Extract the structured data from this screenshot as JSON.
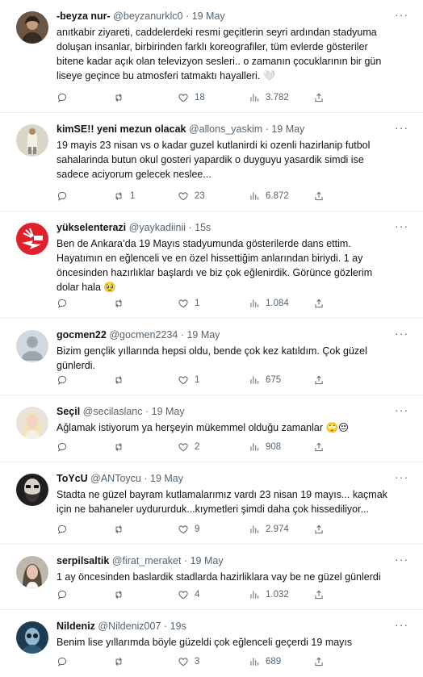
{
  "more_label": "···",
  "tweets": [
    {
      "name": "-beyza nur-",
      "handle": "@beyzanurklc0",
      "time": "19 May",
      "lines": [
        "anıtkabir ziyareti, caddelerdeki resmi geçitlerin seyri ardından stadyuma",
        "doluşan insanlar, birbirinden farklı koreografiler, tüm evlerde gösteriler",
        "bitene kadar açık olan televizyon sesleri.. o zamanın çocuklarının bir gün",
        "liseye geçince bu atmosferi tatmaktı hayalleri. 🤍"
      ],
      "replies": "",
      "retweets": "",
      "likes": "18",
      "views": "3.782"
    },
    {
      "name": "kimSE!! yeni mezun olacak",
      "handle": "@allons_yaskim",
      "time": "19 May",
      "lines": [
        "19 mayis 23 nisan vs o kadar guzel kutlanirdi ki ozenli hazirlanip futbol",
        "sahalarinda butun okul gosteri yapardik o duyguyu yasardik simdi ise",
        "sadece aciyorum gelecek neslee..."
      ],
      "replies": "",
      "retweets": "1",
      "likes": "23",
      "views": "6.872"
    },
    {
      "name": "yükselenterazi",
      "handle": "@yaykadiinii",
      "time": "15s",
      "lines": [
        "Ben de Ankara’da 19 Mayıs stadyumunda gösterilerde dans ettim.",
        "Hayatımın en eğlenceli ve en özel hissettiğim anlarından biriydi. 1 ay",
        "öncesinden hazırlıklar başlardı ve biz çok eğlenirdik. Görünce gözlerim",
        "dolar hala 🥹"
      ],
      "replies": "",
      "retweets": "",
      "likes": "1",
      "views": "1.084"
    },
    {
      "name": "gocmen22",
      "handle": "@gocmen2234",
      "time": "19 May",
      "lines": [
        "Bizim gençlik yıllarında hepsi oldu, bende çok kez katıldım. Çok güzel",
        "günlerdi."
      ],
      "replies": "",
      "retweets": "",
      "likes": "1",
      "views": "675"
    },
    {
      "name": "Seçil",
      "handle": "@secilaslanc",
      "time": "19 May",
      "lines": [
        "Ağlamak istiyorum ya herşeyin mükemmel olduğu zamanlar 🙄😔"
      ],
      "replies": "",
      "retweets": "",
      "likes": "2",
      "views": "908"
    },
    {
      "name": "ToYcU",
      "handle": "@ANToycu",
      "time": "19 May",
      "lines": [
        "Stadta ne güzel bayram kutlamalarımız vardı 23 nisan 19 mayıs... kaçmak",
        "için ne bahaneler uydururduk...kıymetleri şimdi daha çok hissediliyor..."
      ],
      "replies": "",
      "retweets": "",
      "likes": "9",
      "views": "2.974"
    },
    {
      "name": "serpilsaltik",
      "handle": "@firat_meraket",
      "time": "19 May",
      "lines": [
        "1 ay öncesinden baslardik stadlarda hazirliklara vay be ne güzel günlerdi"
      ],
      "replies": "",
      "retweets": "",
      "likes": "4",
      "views": "1.032"
    },
    {
      "name": "Nildeniz",
      "handle": "@Nildeniz007",
      "time": "19s",
      "lines": [
        "Benim  lise yıllarımda böyle güzeldi  çok eğlenceli geçerdi 19 mayıs"
      ],
      "replies": "",
      "retweets": "",
      "likes": "3",
      "views": "689"
    }
  ]
}
